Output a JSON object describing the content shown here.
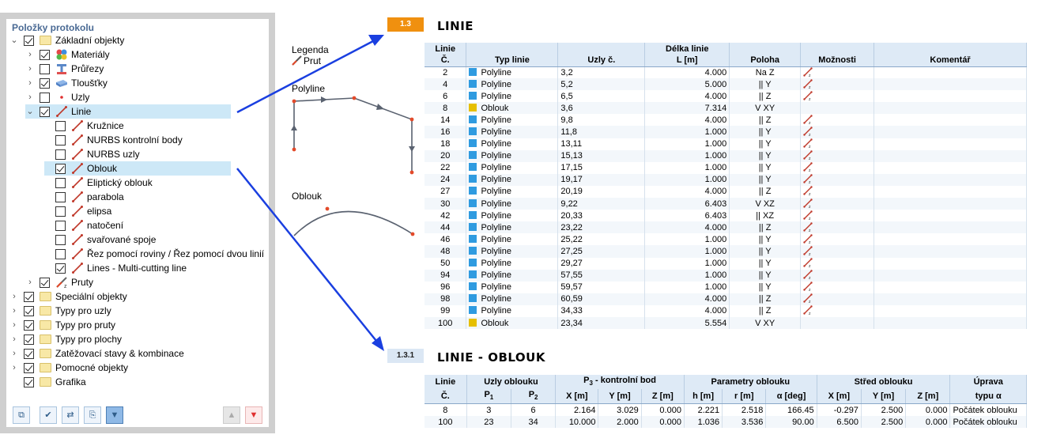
{
  "panel": {
    "title": "Položky protokolu",
    "items": [
      {
        "label": "Základní objekty",
        "level": 0,
        "expanded": true,
        "checked": true,
        "icon": "folder-icon"
      },
      {
        "label": "Materiály",
        "level": 1,
        "expanded": false,
        "checked": true,
        "icon": "materials-icon"
      },
      {
        "label": "Průřezy",
        "level": 1,
        "expanded": false,
        "checked": false,
        "icon": "section-icon"
      },
      {
        "label": "Tloušťky",
        "level": 1,
        "expanded": false,
        "checked": true,
        "icon": "thickness-icon"
      },
      {
        "label": "Uzly",
        "level": 1,
        "expanded": false,
        "checked": false,
        "icon": "node-icon"
      },
      {
        "label": "Linie",
        "level": 1,
        "expanded": true,
        "checked": true,
        "icon": "line-icon",
        "selected": true
      },
      {
        "label": "Kružnice",
        "level": 2,
        "checked": false,
        "icon": "line-icon"
      },
      {
        "label": "NURBS kontrolní body",
        "level": 2,
        "checked": false,
        "icon": "line-icon"
      },
      {
        "label": "NURBS uzly",
        "level": 2,
        "checked": false,
        "icon": "line-icon"
      },
      {
        "label": "Oblouk",
        "level": 2,
        "checked": true,
        "icon": "line-icon",
        "selected": true
      },
      {
        "label": "Eliptický oblouk",
        "level": 2,
        "checked": false,
        "icon": "line-icon"
      },
      {
        "label": "parabola",
        "level": 2,
        "checked": false,
        "icon": "line-icon"
      },
      {
        "label": "elipsa",
        "level": 2,
        "checked": false,
        "icon": "line-icon"
      },
      {
        "label": "natočení",
        "level": 2,
        "checked": false,
        "icon": "line-icon"
      },
      {
        "label": "svařované spoje",
        "level": 2,
        "checked": false,
        "icon": "line-icon"
      },
      {
        "label": "Řez pomocí roviny / Řez pomocí dvou linií",
        "level": 2,
        "checked": false,
        "icon": "line-icon"
      },
      {
        "label": "Lines - Multi-cutting line",
        "level": 2,
        "checked": true,
        "icon": "line-icon"
      },
      {
        "label": "Pruty",
        "level": 1,
        "expanded": false,
        "checked": true,
        "icon": "member-icon"
      },
      {
        "label": "Speciální objekty",
        "level": 0,
        "expanded": false,
        "checked": true,
        "icon": "folder-icon"
      },
      {
        "label": "Typy pro uzly",
        "level": 0,
        "expanded": false,
        "checked": true,
        "icon": "folder-icon"
      },
      {
        "label": "Typy pro pruty",
        "level": 0,
        "expanded": false,
        "checked": true,
        "icon": "folder-icon"
      },
      {
        "label": "Typy pro plochy",
        "level": 0,
        "expanded": false,
        "checked": true,
        "icon": "folder-icon"
      },
      {
        "label": "Zatěžovací stavy & kombinace",
        "level": 0,
        "expanded": false,
        "checked": true,
        "icon": "folder-icon"
      },
      {
        "label": "Pomocné objekty",
        "level": 0,
        "expanded": false,
        "checked": true,
        "icon": "folder-icon"
      },
      {
        "label": "Grafika",
        "level": 0,
        "expanded": null,
        "checked": true,
        "icon": "folder-icon"
      }
    ]
  },
  "legend": {
    "title": "Legenda",
    "prut_label": "Prut",
    "polyline_label": "Polyline",
    "oblouk_label": "Oblouk"
  },
  "section1": {
    "badge": "1.3",
    "title": "LINIE",
    "headers": {
      "linie_top": "Linie",
      "linie_bottom": "Č.",
      "typ": "Typ linie",
      "uzly": "Uzly č.",
      "delka_top": "Délka linie",
      "delka_bottom": "L [m]",
      "poloha": "Poloha",
      "moznosti": "Možnosti",
      "komentar": "Komentář"
    },
    "rows": [
      {
        "no": "2",
        "type": "Polyline",
        "color": "#2f9be0",
        "nodes": "3,2",
        "length": "4.000",
        "pos": "Na Z",
        "opt": true
      },
      {
        "no": "4",
        "type": "Polyline",
        "color": "#2f9be0",
        "nodes": "5,2",
        "length": "5.000",
        "pos": "|| Y",
        "opt": true
      },
      {
        "no": "6",
        "type": "Polyline",
        "color": "#2f9be0",
        "nodes": "6,5",
        "length": "4.000",
        "pos": "|| Z",
        "opt": true
      },
      {
        "no": "8",
        "type": "Oblouk",
        "color": "#e6bf00",
        "nodes": "3,6",
        "length": "7.314",
        "pos": "V XY",
        "opt": false
      },
      {
        "no": "14",
        "type": "Polyline",
        "color": "#2f9be0",
        "nodes": "9,8",
        "length": "4.000",
        "pos": "|| Z",
        "opt": true
      },
      {
        "no": "16",
        "type": "Polyline",
        "color": "#2f9be0",
        "nodes": "11,8",
        "length": "1.000",
        "pos": "|| Y",
        "opt": true
      },
      {
        "no": "18",
        "type": "Polyline",
        "color": "#2f9be0",
        "nodes": "13,11",
        "length": "1.000",
        "pos": "|| Y",
        "opt": true
      },
      {
        "no": "20",
        "type": "Polyline",
        "color": "#2f9be0",
        "nodes": "15,13",
        "length": "1.000",
        "pos": "|| Y",
        "opt": true
      },
      {
        "no": "22",
        "type": "Polyline",
        "color": "#2f9be0",
        "nodes": "17,15",
        "length": "1.000",
        "pos": "|| Y",
        "opt": true
      },
      {
        "no": "24",
        "type": "Polyline",
        "color": "#2f9be0",
        "nodes": "19,17",
        "length": "1.000",
        "pos": "|| Y",
        "opt": true
      },
      {
        "no": "27",
        "type": "Polyline",
        "color": "#2f9be0",
        "nodes": "20,19",
        "length": "4.000",
        "pos": "|| Z",
        "opt": true
      },
      {
        "no": "30",
        "type": "Polyline",
        "color": "#2f9be0",
        "nodes": "9,22",
        "length": "6.403",
        "pos": "V XZ",
        "opt": true
      },
      {
        "no": "42",
        "type": "Polyline",
        "color": "#2f9be0",
        "nodes": "20,33",
        "length": "6.403",
        "pos": "|| XZ",
        "opt": true
      },
      {
        "no": "44",
        "type": "Polyline",
        "color": "#2f9be0",
        "nodes": "23,22",
        "length": "4.000",
        "pos": "|| Z",
        "opt": true
      },
      {
        "no": "46",
        "type": "Polyline",
        "color": "#2f9be0",
        "nodes": "25,22",
        "length": "1.000",
        "pos": "|| Y",
        "opt": true
      },
      {
        "no": "48",
        "type": "Polyline",
        "color": "#2f9be0",
        "nodes": "27,25",
        "length": "1.000",
        "pos": "|| Y",
        "opt": true
      },
      {
        "no": "50",
        "type": "Polyline",
        "color": "#2f9be0",
        "nodes": "29,27",
        "length": "1.000",
        "pos": "|| Y",
        "opt": true
      },
      {
        "no": "94",
        "type": "Polyline",
        "color": "#2f9be0",
        "nodes": "57,55",
        "length": "1.000",
        "pos": "|| Y",
        "opt": true
      },
      {
        "no": "96",
        "type": "Polyline",
        "color": "#2f9be0",
        "nodes": "59,57",
        "length": "1.000",
        "pos": "|| Y",
        "opt": true
      },
      {
        "no": "98",
        "type": "Polyline",
        "color": "#2f9be0",
        "nodes": "60,59",
        "length": "4.000",
        "pos": "|| Z",
        "opt": true
      },
      {
        "no": "99",
        "type": "Polyline",
        "color": "#2f9be0",
        "nodes": "34,33",
        "length": "4.000",
        "pos": "|| Z",
        "opt": true
      },
      {
        "no": "100",
        "type": "Oblouk",
        "color": "#e6bf00",
        "nodes": "23,34",
        "length": "5.554",
        "pos": "V XY",
        "opt": false
      }
    ]
  },
  "section2": {
    "badge": "1.3.1",
    "title": "LINIE - OBLOUK",
    "headers": {
      "linie_top": "Linie",
      "linie_bottom": "Č.",
      "uzly": "Uzly oblouku",
      "p1": "P",
      "p1_sub": "1",
      "p2": "P",
      "p2_sub": "2",
      "kontrol": "P",
      "kontrol_sub": "3",
      "kontrol_rest": " - kontrolní bod",
      "kx": "X [m]",
      "ky": "Y [m]",
      "kz": "Z [m]",
      "param": "Parametry oblouku",
      "h": "h [m]",
      "r": "r [m]",
      "a": "α [deg]",
      "stred": "Střed oblouku",
      "sx": "X [m]",
      "sy": "Y [m]",
      "sz": "Z [m]",
      "uprava_top": "Úprava",
      "uprava_bottom": "typu α"
    },
    "rows": [
      {
        "no": "8",
        "p1": "3",
        "p2": "6",
        "x": "2.164",
        "y": "3.029",
        "z": "0.000",
        "h": "2.221",
        "r": "2.518",
        "a": "166.45",
        "sx": "-0.297",
        "sy": "2.500",
        "sz": "0.000",
        "u": "Počátek oblouku"
      },
      {
        "no": "100",
        "p1": "23",
        "p2": "34",
        "x": "10.000",
        "y": "2.000",
        "z": "0.000",
        "h": "1.036",
        "r": "3.536",
        "a": "90.00",
        "sx": "6.500",
        "sy": "2.500",
        "sz": "0.000",
        "u": "Počátek oblouku"
      }
    ]
  },
  "colors": {
    "accent_orange": "#f0900f",
    "selection": "#cde8f7",
    "header_bg": "#deeaf6",
    "arrow_blue": "#1a3fe0"
  }
}
